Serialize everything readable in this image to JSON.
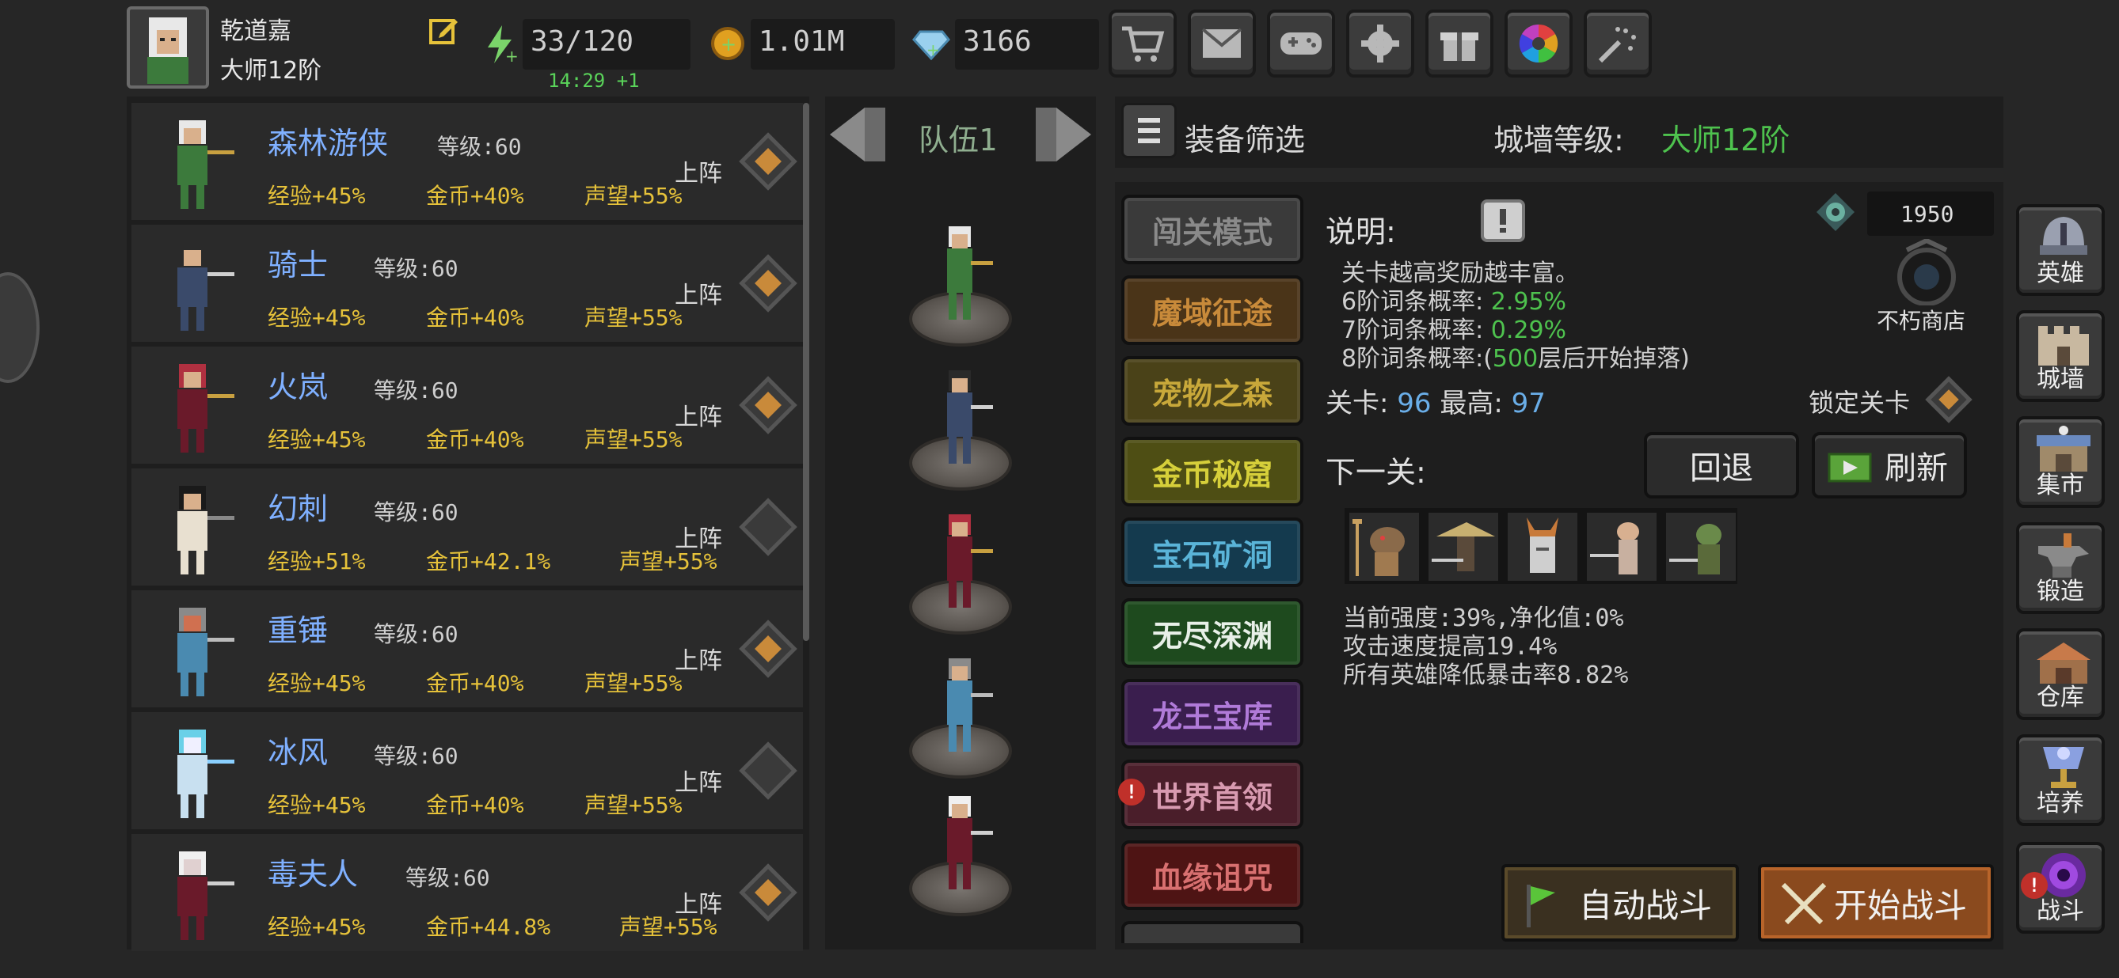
{
  "player": {
    "name": "乾道嘉",
    "rank": "大师12阶"
  },
  "resources": {
    "energy": "33/120",
    "energy_timer": "14:29 +1",
    "gold": "1.01M",
    "gems": "3166"
  },
  "top_buttons": [
    "shop",
    "mail",
    "gamepad",
    "settings",
    "gift",
    "color-wheel",
    "fireworks"
  ],
  "heroes": [
    {
      "name": "森林游侠",
      "level": "等级:60",
      "exp": "经验+45%",
      "gold": "金币+40%",
      "fame": "声望+55%",
      "deploy": "上阵",
      "active": true,
      "name_color": "#7fb0ff"
    },
    {
      "name": "骑士",
      "level": "等级:60",
      "exp": "经验+45%",
      "gold": "金币+40%",
      "fame": "声望+55%",
      "deploy": "上阵",
      "active": true
    },
    {
      "name": "火岚",
      "level": "等级:60",
      "exp": "经验+45%",
      "gold": "金币+40%",
      "fame": "声望+55%",
      "deploy": "上阵",
      "active": true
    },
    {
      "name": "幻刺",
      "level": "等级:60",
      "exp": "经验+51%",
      "gold": "金币+42.1%",
      "fame": "声望+55%",
      "deploy": "上阵",
      "active": false
    },
    {
      "name": "重锤",
      "level": "等级:60",
      "exp": "经验+45%",
      "gold": "金币+40%",
      "fame": "声望+55%",
      "deploy": "上阵",
      "active": true
    },
    {
      "name": "冰风",
      "level": "等级:60",
      "exp": "经验+45%",
      "gold": "金币+40%",
      "fame": "声望+55%",
      "deploy": "上阵",
      "active": false
    },
    {
      "name": "毒夫人",
      "level": "等级:60",
      "exp": "经验+45%",
      "gold": "金币+44.8%",
      "fame": "声望+55%",
      "deploy": "上阵",
      "active": true
    }
  ],
  "team": {
    "label": "队伍1"
  },
  "filter": {
    "label": "装备筛选",
    "wall_label": "城墙等级:",
    "wall_value": "大师12阶"
  },
  "modes": [
    {
      "label": "闯关模式",
      "bg": "#3a3a3a",
      "fg": "#8a8a8a"
    },
    {
      "label": "魔域征途",
      "bg": "#4a3418",
      "fg": "#c88a3a"
    },
    {
      "label": "宠物之森",
      "bg": "#4a4218",
      "fg": "#c8a83a"
    },
    {
      "label": "金币秘窟",
      "bg": "#4e4e14",
      "fg": "#d6cf3a"
    },
    {
      "label": "宝石矿洞",
      "bg": "#143a4e",
      "fg": "#5ab4d8"
    },
    {
      "label": "无尽深渊",
      "bg": "#1e4a1e",
      "fg": "#e8f0e8"
    },
    {
      "label": "龙王宝库",
      "bg": "#3a1e4e",
      "fg": "#b07ad8"
    },
    {
      "label": "世界首领",
      "bg": "#4a1e2a",
      "fg": "#d89ab0"
    },
    {
      "label": "血缘诅咒",
      "bg": "#4e1414",
      "fg": "#d87070"
    }
  ],
  "description": {
    "title": "说明:",
    "line1": "关卡越高奖励越丰富。",
    "tier6_label": "6阶词条概率:",
    "tier6_value": "2.95%",
    "tier7_label": "7阶词条概率:",
    "tier7_value": "0.29%",
    "tier8_prefix": "8阶词条概率:(",
    "tier8_value": "500",
    "tier8_suffix": "层后开始掉落)"
  },
  "currency": {
    "value": "1950",
    "shop_label": "不朽商店"
  },
  "stage": {
    "stage_label": "关卡:",
    "stage_value": "96",
    "best_label": "最高:",
    "best_value": "97",
    "lock_label": "锁定关卡"
  },
  "next": {
    "label": "下一关:",
    "back_button": "回退",
    "refresh_button": "刷新"
  },
  "effects": [
    "当前强度:39%,净化值:0%",
    "攻击速度提高19.4%",
    "所有英雄降低暴击率8.82%"
  ],
  "battle": {
    "auto": "自动战斗",
    "start": "开始战斗"
  },
  "nav": [
    {
      "label": "英雄",
      "icon": "helmet-icon"
    },
    {
      "label": "城墙",
      "icon": "castle-wall-icon"
    },
    {
      "label": "集市",
      "icon": "market-icon"
    },
    {
      "label": "锻造",
      "icon": "anvil-icon"
    },
    {
      "label": "仓库",
      "icon": "warehouse-icon"
    },
    {
      "label": "培养",
      "icon": "chalice-icon"
    },
    {
      "label": "战斗",
      "icon": "portal-icon"
    }
  ],
  "colors": {
    "accent_green": "#4ec24e",
    "hero_name": "#7fb0ff",
    "stat_gold": "#e6c23a",
    "deploy_orange": "#c98a3a"
  }
}
